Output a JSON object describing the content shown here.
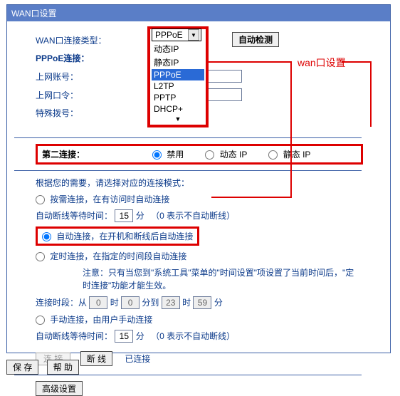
{
  "panel": {
    "title": "WAN口设置"
  },
  "annotation": "wan口设置",
  "wan": {
    "type_label": "WAN口连接类型：",
    "type_value": "PPPoE",
    "autodetect_btn": "自动检测",
    "options": [
      "动态IP",
      "静态IP",
      "PPPoE",
      "L2TP",
      "PPTP",
      "DHCP+"
    ],
    "options_more": "▼"
  },
  "pppoe": {
    "header": "PPPoE连接：",
    "account_label": "上网账号：",
    "password_label": "上网口令：",
    "special_label": "特殊拨号："
  },
  "second": {
    "label": "第二连接：",
    "disable": "禁用",
    "dyn": "动态 IP",
    "stat": "静态 IP"
  },
  "mode": {
    "intro": "根据您的需要，请选择对应的连接模式：",
    "ondemand": "按需连接，在有访问时自动连接",
    "auto_wait_label": "自动断线等待时间：",
    "auto_wait_val": "15",
    "minutes": "分",
    "wait_note": "（0 表示不自动断线）",
    "auto": "自动连接，在开机和断线后自动连接",
    "sched": "定时连接，在指定的时间段自动连接",
    "sched_note": "注意：只有当您到\"系统工具\"菜单的\"时间设置\"项设置了当前时间后，\"定时连接\"功能才能生效。",
    "period_label": "连接时段：从",
    "h1": "0",
    "m1": "0",
    "between": "分到",
    "h2": "23",
    "hlabel": "时",
    "m2": "59",
    "mlabel": "分",
    "manual": "手动连接，由用户手动连接",
    "wait2_val": "15"
  },
  "status": {
    "connect_btn": "连 接",
    "disconnect_btn": "断 线",
    "state": "已连接"
  },
  "adv_btn": "高级设置",
  "bottom": {
    "save": "保 存",
    "help": "帮 助"
  }
}
